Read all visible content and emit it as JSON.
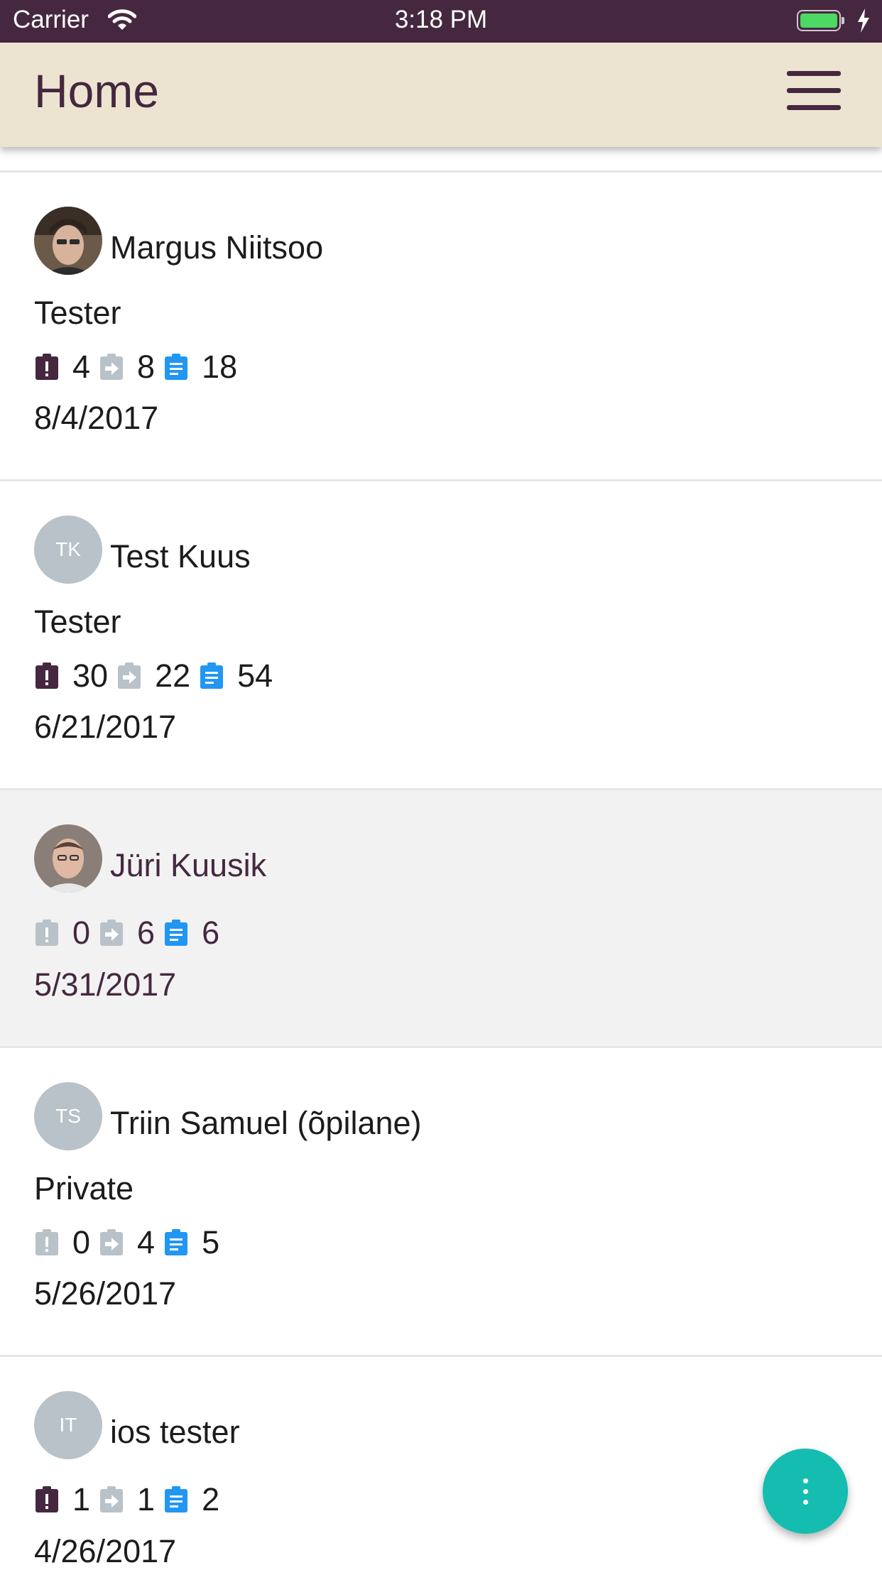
{
  "status_bar": {
    "carrier": "Carrier",
    "time": "3:18 PM"
  },
  "header": {
    "title": "Home",
    "menu_icon": "hamburger-menu-icon"
  },
  "colors": {
    "primary": "#45283f",
    "header_bg": "#ece4d0",
    "accent": "#15bcb0",
    "issue_active": "#45283f",
    "inactive": "#b8c2c8",
    "notes": "#2196f3"
  },
  "icons": {
    "issues": "exclamation-clipboard-icon",
    "tasks": "arrow-right-box-icon",
    "notes": "clipboard-list-icon",
    "fab": "more-vertical-icon"
  },
  "contacts": [
    {
      "name": "Margus Niitsoo",
      "role": "Tester",
      "issues": "4",
      "tasks": "8",
      "notes": "18",
      "date": "8/4/2017",
      "avatar": "photo"
    },
    {
      "name": "Test Kuus",
      "initials": "TK",
      "role": "Tester",
      "issues": "30",
      "tasks": "22",
      "notes": "54",
      "date": "6/21/2017"
    },
    {
      "name": "Jüri Kuusik",
      "issues": "0",
      "tasks": "6",
      "notes": "6",
      "date": "5/31/2017",
      "avatar": "photo"
    },
    {
      "name": "Triin Samuel (õpilane)",
      "initials": "TS",
      "role": "Private",
      "issues": "0",
      "tasks": "4",
      "notes": "5",
      "date": "5/26/2017"
    },
    {
      "name": "ios tester",
      "initials": "IT",
      "issues": "1",
      "tasks": "1",
      "notes": "2",
      "date": "4/26/2017"
    }
  ]
}
